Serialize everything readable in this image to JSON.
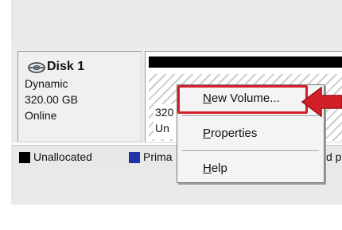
{
  "disk": {
    "name": "Disk 1",
    "type": "Dynamic",
    "size": "320.00 GB",
    "status": "Online",
    "icon": "disk-icon"
  },
  "volume": {
    "size_text": "320",
    "status_text": "Un"
  },
  "legend": {
    "items": [
      {
        "label": "Unallocated",
        "color": "#000000"
      },
      {
        "label": "Prima",
        "color": "#1f35a8"
      }
    ],
    "trailing_text": "d p"
  },
  "context_menu": {
    "items": [
      {
        "label": "New Volume..."
      },
      {
        "label": "Properties"
      },
      {
        "label": "Help"
      }
    ],
    "highlight_color": "#d32028"
  }
}
